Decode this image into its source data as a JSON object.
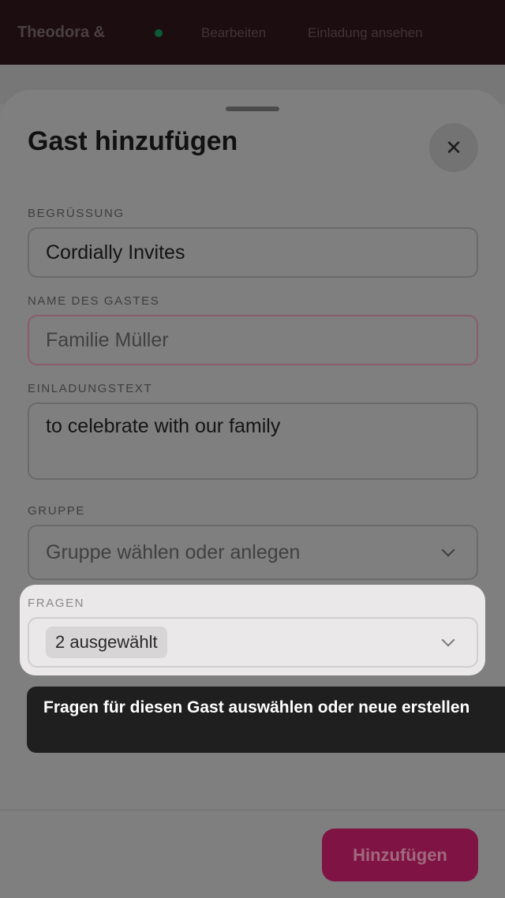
{
  "background": {
    "title": "Theodora &",
    "links": [
      "Bearbeiten",
      "Einladung ansehen"
    ]
  },
  "sheet": {
    "title": "Gast hinzufügen",
    "close_icon": "close-icon",
    "fields": {
      "greeting": {
        "label": "BEGRÜSSUNG",
        "value": "Cordially Invites"
      },
      "guest_name": {
        "label": "NAME DES GASTES",
        "placeholder": "Familie Müller",
        "value": ""
      },
      "invitation_text": {
        "label": "EINLADUNGSTEXT",
        "value": "to celebrate with our family"
      },
      "group": {
        "label": "GRUPPE",
        "placeholder": "Gruppe wählen oder anlegen"
      },
      "questions": {
        "label": "FRAGEN",
        "selected": "2 ausgewählt"
      }
    },
    "tooltip": "Fragen für diesen Gast auswählen oder neue erstellen",
    "submit_label": "Hinzufügen"
  },
  "colors": {
    "accent": "#b3125e",
    "tooltip_bg": "#1f1f1f",
    "overlay": "#7f7f7f"
  }
}
